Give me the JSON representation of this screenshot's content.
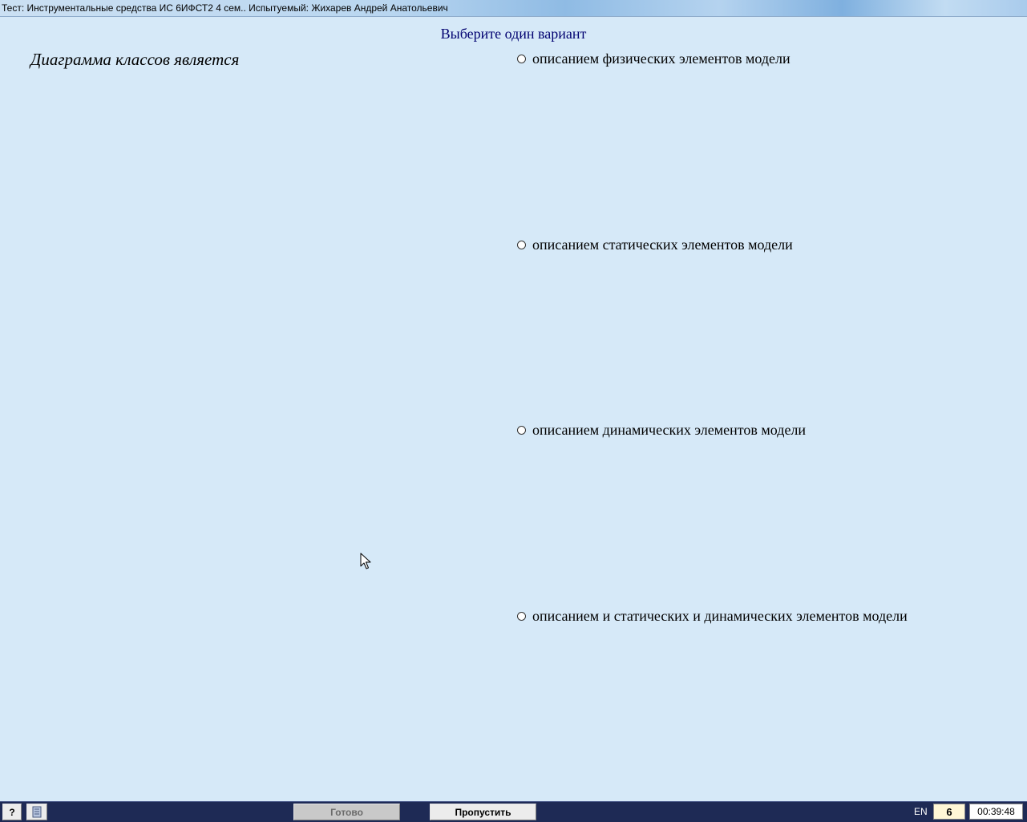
{
  "window": {
    "title": "Тест: Инструментальные средства ИС 6ИФСТ2 4 сем.. Испытуемый: Жихарев Андрей Анатольевич"
  },
  "instruction": "Выберите один вариант",
  "question": "Диаграмма классов является",
  "options": [
    {
      "label": "описанием физических элементов модели",
      "selected": false
    },
    {
      "label": "описанием статических элементов модели",
      "selected": false
    },
    {
      "label": "описанием динамических элементов модели",
      "selected": false
    },
    {
      "label": "описанием и статических и динамических элементов модели",
      "selected": false
    }
  ],
  "toolbar": {
    "help_label": "?",
    "notes_icon": "notepad-icon",
    "done_label": "Готово",
    "done_enabled": false,
    "skip_label": "Пропустить",
    "language": "EN",
    "question_number": "6",
    "timer": "00:39:48"
  },
  "colors": {
    "background": "#d6e9f8",
    "instruction_text": "#000070",
    "taskbar": "#1e2a55"
  }
}
